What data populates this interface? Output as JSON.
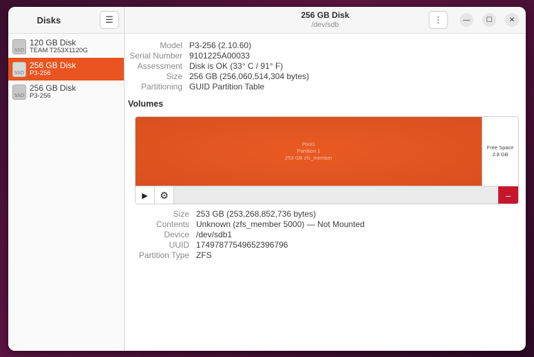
{
  "sidebar": {
    "title": "Disks",
    "menu_icon": "hamburger-icon",
    "items": [
      {
        "name": "120 GB Disk",
        "sub": "TEAM T253X1120G",
        "badge": "SSD",
        "selected": false
      },
      {
        "name": "256 GB Disk",
        "sub": "P3-256",
        "badge": "SSD",
        "selected": true
      },
      {
        "name": "256 GB Disk",
        "sub": "P3-256",
        "badge": "SSD",
        "selected": false
      }
    ]
  },
  "header": {
    "title": "256 GB Disk",
    "subtitle": "/dev/sdb",
    "menu_icon": "kebab-icon",
    "minimize_icon": "minimize-icon",
    "maximize_icon": "maximize-icon",
    "close_icon": "close-icon"
  },
  "disk_props": [
    {
      "label": "Model",
      "value": "P3-256 (2.10.60)"
    },
    {
      "label": "Serial Number",
      "value": "9101225A00033"
    },
    {
      "label": "Assessment",
      "value": "Disk is OK (33° C / 91° F)"
    },
    {
      "label": "Size",
      "value": "256 GB (256,060,514,304 bytes)"
    },
    {
      "label": "Partitioning",
      "value": "GUID Partition Table"
    }
  ],
  "volumes": {
    "title": "Volumes",
    "partition": {
      "line1": "Pool1",
      "line2": "Partition 1",
      "line3": "253 GB zfs_member"
    },
    "free": {
      "line1": "Free Space",
      "line2": "2.8 GB"
    },
    "play_icon": "play-icon",
    "gear_icon": "gear-icon",
    "delete_icon": "minus-icon",
    "delete_label": "−",
    "play_label": "▶",
    "gear_label": "⚙"
  },
  "volume_props": [
    {
      "label": "Size",
      "value": "253 GB (253,268,852,736 bytes)"
    },
    {
      "label": "Contents",
      "value": "Unknown (zfs_member 5000) — Not Mounted"
    },
    {
      "label": "Device",
      "value": "/dev/sdb1"
    },
    {
      "label": "UUID",
      "value": "17497877549652396796"
    },
    {
      "label": "Partition Type",
      "value": "ZFS"
    }
  ],
  "colors": {
    "accent": "#e95420",
    "danger": "#c7162b"
  }
}
